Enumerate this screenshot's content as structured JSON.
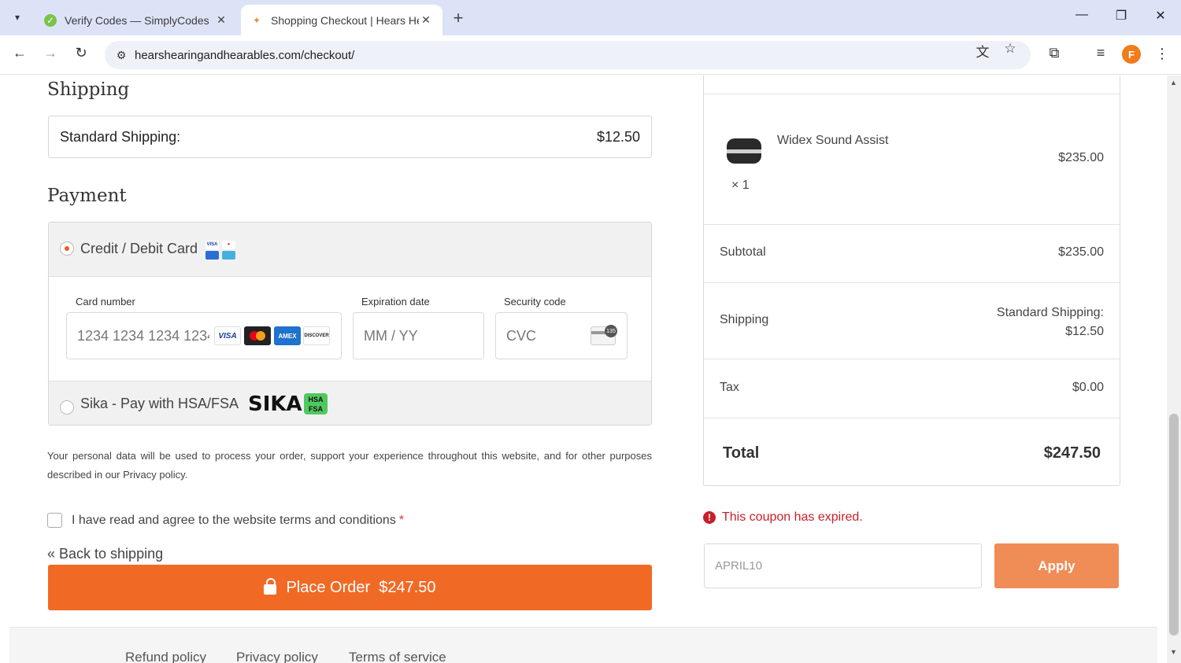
{
  "browser": {
    "tabs": [
      {
        "title": "Verify Codes — SimplyCodes",
        "favicon": "simplycodes-icon"
      },
      {
        "title": "Shopping Checkout | Hears Hea",
        "favicon": "hears-icon"
      }
    ],
    "url": "hearshearingandhearables.com/checkout/",
    "profile_initial": "F"
  },
  "shipping": {
    "heading": "Shipping",
    "method_label": "Standard Shipping:",
    "method_price": "$12.50"
  },
  "payment": {
    "heading": "Payment",
    "card_option_label": "Credit / Debit Card",
    "card_number_label": "Card number",
    "card_number_placeholder": "1234 1234 1234 1234",
    "expiry_label": "Expiration date",
    "expiry_placeholder": "MM / YY",
    "cvc_label": "Security code",
    "cvc_placeholder": "CVC",
    "cvc_badge": "135",
    "brands": [
      "VISA",
      "MC",
      "AMEX",
      "DISCOVER"
    ],
    "sika_label": "Sika - Pay with HSA/FSA",
    "sika_logo": "SIKA",
    "sika_badge_top": "HSA",
    "sika_badge_bottom": "FSA"
  },
  "privacy_text": "Your personal data will be used to process your order, support your experience throughout this website, and for other purposes described in our Privacy policy.",
  "terms_label": "I have read and agree to the website terms and conditions",
  "terms_required": "*",
  "back_link": "« Back to shipping",
  "place_order": "Place Order  $247.50",
  "summary": {
    "product_name": "Widex Sound Assist",
    "product_qty": "× 1",
    "product_price": "$235.00",
    "subtotal_label": "Subtotal",
    "subtotal_value": "$235.00",
    "shipping_label": "Shipping",
    "shipping_value_line1": "Standard Shipping:",
    "shipping_value_line2": "$12.50",
    "tax_label": "Tax",
    "tax_value": "$0.00",
    "total_label": "Total",
    "total_value": "$247.50"
  },
  "coupon": {
    "error": "This coupon has expired.",
    "value": "APRIL10",
    "apply_label": "Apply"
  },
  "footer": {
    "links": [
      "Refund policy",
      "Privacy policy",
      "Terms of service"
    ]
  },
  "colors": {
    "accent": "#f06a25",
    "apply": "#f08c55",
    "error": "#c7202b"
  }
}
